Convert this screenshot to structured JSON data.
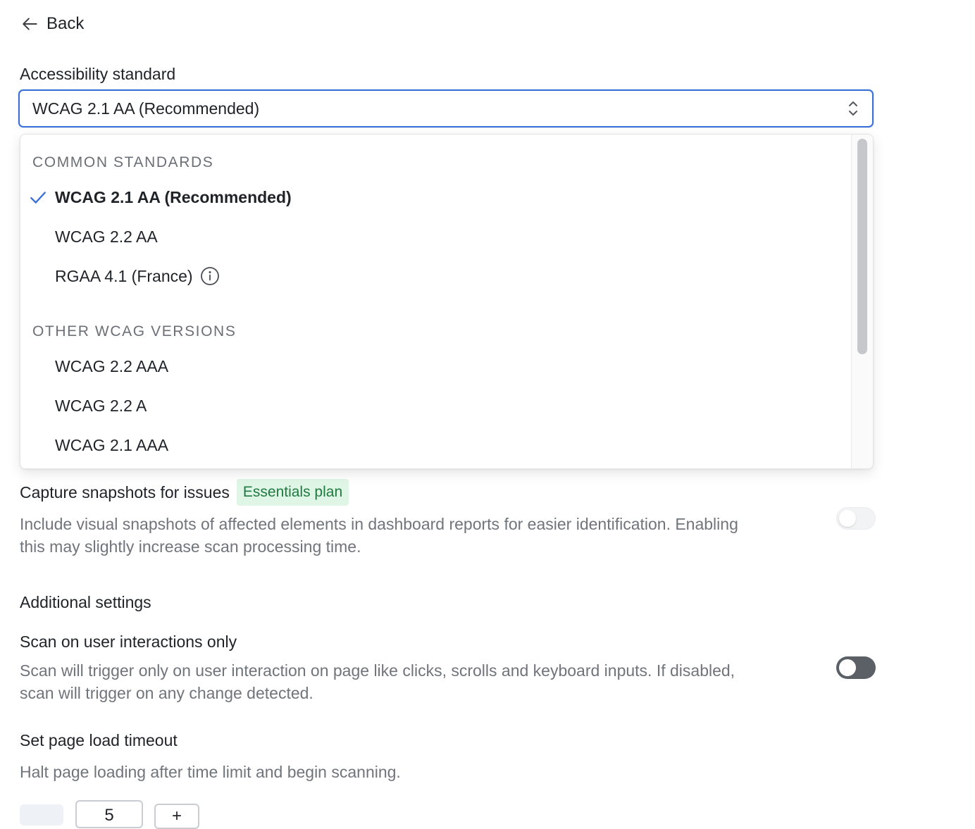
{
  "back": {
    "label": "Back"
  },
  "standard": {
    "label": "Accessibility standard",
    "selected": "WCAG 2.1 AA (Recommended)"
  },
  "dropdown": {
    "groups": [
      {
        "label": "COMMON STANDARDS",
        "options": [
          {
            "label": "WCAG 2.1 AA (Recommended)",
            "selected": true
          },
          {
            "label": "WCAG 2.2 AA",
            "selected": false
          },
          {
            "label": "RGAA 4.1 (France)",
            "selected": false,
            "icon": "info-icon"
          }
        ]
      },
      {
        "label": "OTHER WCAG VERSIONS",
        "options": [
          {
            "label": "WCAG 2.2 AAA",
            "selected": false
          },
          {
            "label": "WCAG 2.2 A",
            "selected": false
          },
          {
            "label": "WCAG 2.1 AAA",
            "selected": false
          }
        ]
      }
    ]
  },
  "snapshots": {
    "title": "Capture snapshots for issues",
    "badge": "Essentials plan",
    "description_line1": "Include visual snapshots of affected elements in dashboard reports for easier identification. Enabling",
    "description_line2": "this may slightly increase scan processing time.",
    "toggle_on": false,
    "toggle_disabled": true
  },
  "additional": {
    "heading": "Additional settings"
  },
  "interactions": {
    "title": "Scan on user interactions only",
    "description_line1": "Scan will trigger only on user interaction on page like clicks, scrolls and keyboard inputs. If disabled,",
    "description_line2": "scan will trigger on any change detected.",
    "toggle_on": false
  },
  "timeout": {
    "title": "Set page load timeout",
    "description": "Halt page loading after time limit and begin scanning.",
    "value": "5",
    "increment_label": "+"
  },
  "colors": {
    "accent": "#3a6fd8",
    "badge_bg": "#dff5e6",
    "badge_text": "#1f7a3f",
    "toggle_off": "#5b5f66"
  }
}
